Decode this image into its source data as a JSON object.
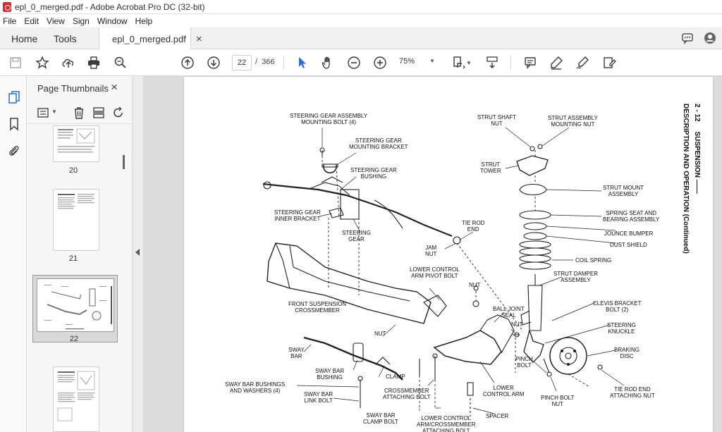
{
  "window": {
    "title": "epl_0_merged.pdf - Adobe Acrobat Pro DC (32-bit)"
  },
  "menu": [
    "File",
    "Edit",
    "View",
    "Sign",
    "Window",
    "Help"
  ],
  "tabs": {
    "home": "Home",
    "tools": "Tools",
    "document": "epl_0_merged.pdf",
    "close": "×"
  },
  "toolbar": {
    "current_page": "22",
    "page_separator": "/",
    "total_pages": "366",
    "zoom": "75%"
  },
  "panel": {
    "title": "Page Thumbnails",
    "close": "×",
    "thumbnails": [
      {
        "label": "20",
        "selected": false
      },
      {
        "label": "21",
        "selected": false
      },
      {
        "label": "22",
        "selected": true
      },
      {
        "label": "",
        "selected": false
      }
    ]
  },
  "document": {
    "header_right_page": "2 - 12",
    "header_right_section": "SUSPENSION",
    "header_subtitle": "DESCRIPTION AND OPERATION (Continued)",
    "labels": {
      "steering_gear_mount_bolt": "STEERING GEAR ASSEMBLY\nMOUNTING BOLT (4)",
      "steering_gear_mount_bracket": "STEERING GEAR\nMOUNTING BRACKET",
      "steering_gear_bushing": "STEERING GEAR\nBUSHING",
      "steering_gear_inner_bracket": "STEERING GEAR\nINNER BRACKET",
      "steering_gear": "STEERING\nGEAR",
      "tie_rod_end": "TIE ROD\nEND",
      "jam_nut": "JAM\nNUT",
      "strut_shaft_nut": "STRUT SHAFT\nNUT",
      "strut_assembly_mount_nut": "STRUT ASSEMBLY\nMOUNTING NUT",
      "strut_tower": "STRUT\nTOWER",
      "strut_mount_assembly": "STRUT MOUNT\nASSEMBLY",
      "spring_seat": "SPRING SEAT AND\nBEARING ASSEMBLY",
      "jounce_bumper": "JOUNCE BUMPER",
      "dust_shield": "DUST SHIELD",
      "coil_spring": "COIL SPRING",
      "strut_damper": "STRUT DAMPER\nASSEMBLY",
      "lower_control_arm_pivot_bolt": "LOWER CONTROL\nARM PIVOT BOLT",
      "front_suspension_crossmember": "FRONT SUSPENSION\nCROSSMEMBER",
      "nut_top": "NUT",
      "ball_joint_seal": "BALL JOINT\nSEAL",
      "nut_mid": "NUT",
      "nut_left": "NUT",
      "clevis_bracket_bolt": "CLEVIS BRACKET\nBOLT (2)",
      "steering_knuckle": "STEERING\nKNUCKLE",
      "braking_disc": "BRAKING\nDISC",
      "sway_bar": "SWAY\nBAR",
      "sway_bar_bushing": "SWAY BAR\nBUSHING",
      "clamp": "CLAMP",
      "pinch_bolt": "PINCH\nBOLT",
      "sway_bar_bushings_washers": "SWAY BAR BUSHINGS\nAND WASHERS (4)",
      "crossmember_attaching_bolt": "CROSSMEMBER\nATTACHING BOLT",
      "lower_control_arm": "LOWER\nCONTROL ARM",
      "pinch_bolt_nut": "PINCH BOLT\nNUT",
      "tie_rod_end_attaching_nut": "TIE ROD END\nATTACHING NUT",
      "sway_bar_link_bolt": "SWAY BAR\nLINK BOLT",
      "sway_bar_clamp_bolt": "SWAY BAR\nCLAMP BOLT",
      "lower_control_arm_crossmember": "LOWER CONTROL\nARM/CROSSMEMBER\nATTACHING BOLT",
      "spacer": "SPACER"
    }
  },
  "colors": {
    "accent_blue": "#2b6fd6",
    "pdf_red": "#d32f2f",
    "toolbar_icon": "#3a3a3a"
  }
}
